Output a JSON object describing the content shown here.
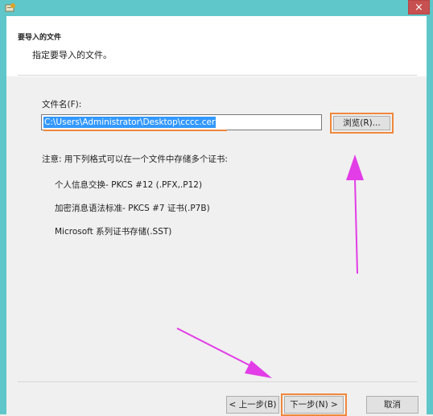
{
  "window": {
    "close_glyph": "×"
  },
  "header": {
    "title": "要导入的文件",
    "subtitle": "指定要导入的文件。"
  },
  "form": {
    "file_label": "文件名(F):",
    "file_value": "C:\\Users\\Administrator\\Desktop\\cccc.cer",
    "browse_label": "浏览(R)...",
    "note": "注意: 用下列格式可以在一个文件中存储多个证书:",
    "formats": [
      "个人信息交换- PKCS #12 (.PFX,.P12)",
      "加密消息语法标准- PKCS #7 证书(.P7B)",
      "Microsoft 系列证书存储(.SST)"
    ]
  },
  "buttons": {
    "back": "< 上一步(B)",
    "next": "下一步(N) >",
    "cancel": "取消"
  },
  "colors": {
    "titlebar": "#5fc7c9",
    "highlight": "#f0883c",
    "arrow": "#e23de6",
    "selection": "#3399ff"
  }
}
